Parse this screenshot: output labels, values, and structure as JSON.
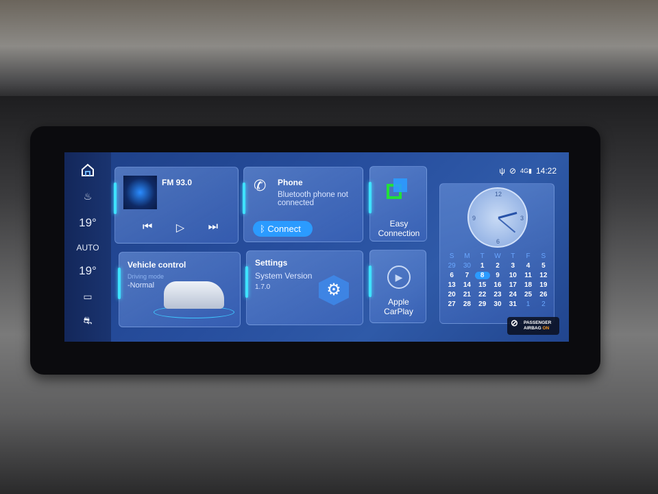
{
  "sidebar": {
    "items": [
      {
        "icon": "home-icon"
      },
      {
        "icon": "front-defrost-icon"
      },
      {
        "label": "19°"
      },
      {
        "label": "AUTO"
      },
      {
        "label": "19°"
      },
      {
        "icon": "rear-defrost-icon"
      },
      {
        "icon": "traction-control-icon"
      }
    ]
  },
  "status": {
    "time": "14:22",
    "network": "4G",
    "icons": [
      "usb-icon",
      "gps-icon",
      "signal-icon"
    ]
  },
  "media": {
    "station": "FM  93.0",
    "controls": [
      "previous-icon",
      "play-icon",
      "next-icon"
    ]
  },
  "phone": {
    "title": "Phone",
    "status": "Bluetooth phone not connected",
    "connect_label": "Connect"
  },
  "easy_connection": {
    "label_line1": "Easy",
    "label_line2": "Connection"
  },
  "vehicle": {
    "title": "Vehicle control",
    "mode_label": "Driving mode",
    "mode_value": "-Normal"
  },
  "settings": {
    "title": "Settings",
    "version_label": "System Version",
    "version": "1.7.0"
  },
  "carplay": {
    "label_line1": "Apple",
    "label_line2": "CarPlay"
  },
  "clock": {
    "numerals": [
      "12",
      "3",
      "6",
      "9"
    ],
    "time": "14:22"
  },
  "calendar": {
    "weekdays": [
      "S",
      "M",
      "T",
      "W",
      "T",
      "F",
      "S"
    ],
    "today": "8",
    "days": [
      "29",
      "30",
      "1",
      "2",
      "3",
      "4",
      "5",
      "6",
      "7",
      "8",
      "9",
      "10",
      "11",
      "12",
      "13",
      "14",
      "15",
      "16",
      "17",
      "18",
      "19",
      "20",
      "21",
      "22",
      "23",
      "24",
      "25",
      "26",
      "27",
      "28",
      "29",
      "30",
      "31",
      "1",
      "2"
    ]
  },
  "airbag": {
    "line1": "PASSENGER",
    "line2": "AIRBAG",
    "state": "ON",
    "state_color": "#ff9a1f"
  },
  "colors": {
    "accent": "#3fe2ff",
    "button": "#2b9bff"
  }
}
